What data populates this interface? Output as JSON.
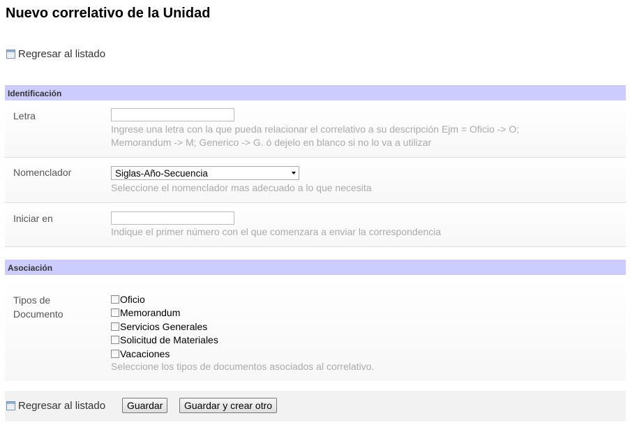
{
  "page_title": "Nuevo correlativo de la Unidad",
  "back_link_label": "Regresar al listado",
  "sections": {
    "identificacion": "Identificación",
    "asociacion": "Asociación"
  },
  "letra": {
    "label": "Letra",
    "value": "",
    "help_line1": "Ingrese una letra con la que pueda relacionar el correlativo a su descripción Ejm = Oficio -> O;",
    "help_line2": "Memorandum -> M; Generico -> G. ó dejelo en blanco si no lo va a utilizar"
  },
  "nomenclador": {
    "label": "Nomenclador",
    "selected": "Siglas-Año-Secuencia",
    "help": "Seleccione el nomenclador mas adecuado a lo que necesita"
  },
  "iniciar_en": {
    "label": "Iniciar en",
    "value": "",
    "help": "Indique el primer número con el que comenzara a enviar la correspondencia"
  },
  "tipos_documento": {
    "label_line1": "Tipos de",
    "label_line2": "Documento",
    "options": [
      "Oficio",
      "Memorandum",
      "Servicios Generales",
      "Solicitud de Materiales",
      "Vacaciones"
    ],
    "help": "Seleccione los tipos de documentos asociados al correlativo."
  },
  "footer": {
    "back_label": "Regresar al listado",
    "save_label": "Guardar",
    "save_new_label": "Guardar y crear otro"
  }
}
